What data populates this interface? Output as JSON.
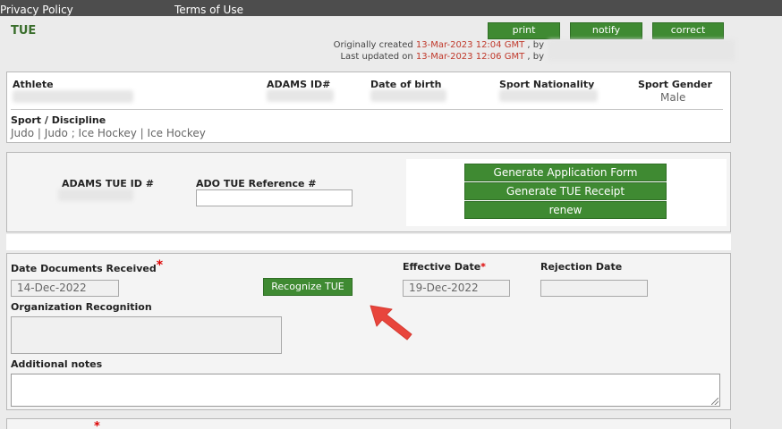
{
  "topbar": {
    "privacy": "Privacy Policy",
    "terms": "Terms of Use"
  },
  "toolbar": {
    "print": "print",
    "notify": "notify",
    "correct": "correct"
  },
  "page": {
    "title": "TUE",
    "created_prefix": "Originally created",
    "created_date": "13-Mar-2023 12:04 GMT",
    "updated_prefix": "Last updated on",
    "updated_date": "13-Mar-2023 12:06 GMT",
    "by": ", by"
  },
  "athlete": {
    "athlete_label": "Athlete",
    "adams_id_label": "ADAMS ID#",
    "dob_label": "Date of birth",
    "nationality_label": "Sport Nationality",
    "gender_label": "Sport Gender",
    "gender_value": "Male",
    "sport_label": "Sport / Discipline",
    "sport_value": "Judo | Judo ; Ice Hockey | Ice Hockey"
  },
  "tue_ids": {
    "adams_tue_id_label": "ADAMS TUE ID #",
    "ado_ref_label": "ADO TUE Reference #",
    "ado_ref_value": "",
    "generate_form": "Generate Application Form",
    "generate_receipt": "Generate TUE Receipt",
    "renew": "renew"
  },
  "recognition": {
    "docs_received_label": "Date Documents Received",
    "docs_received_value": "14-Dec-2022",
    "recognize_button": "Recognize TUE",
    "effective_label": "Effective Date",
    "effective_value": "19-Dec-2022",
    "rejection_label": "Rejection Date",
    "rejection_value": "",
    "org_recognition_label": "Organization Recognition",
    "additional_notes_label": "Additional notes",
    "required_mark": "*"
  },
  "colors": {
    "button_green": "#3f8a32",
    "title_green": "#3a6e2c",
    "date_red": "#c0392b",
    "arrow_red": "#e8453c",
    "topbar": "#4d4d4d"
  },
  "icons": {
    "pointer": "red-arrow-icon",
    "resize": "resize-grip-icon"
  }
}
